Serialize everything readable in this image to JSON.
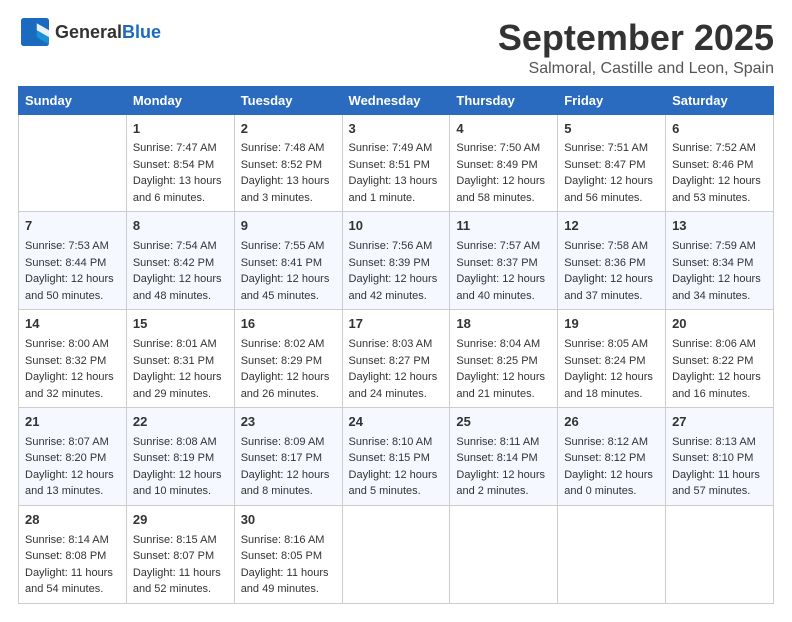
{
  "logo": {
    "general": "General",
    "blue": "Blue"
  },
  "header": {
    "month": "September 2025",
    "location": "Salmoral, Castille and Leon, Spain"
  },
  "weekdays": [
    "Sunday",
    "Monday",
    "Tuesday",
    "Wednesday",
    "Thursday",
    "Friday",
    "Saturday"
  ],
  "weeks": [
    [
      {
        "day": "",
        "info": ""
      },
      {
        "day": "1",
        "info": "Sunrise: 7:47 AM\nSunset: 8:54 PM\nDaylight: 13 hours\nand 6 minutes."
      },
      {
        "day": "2",
        "info": "Sunrise: 7:48 AM\nSunset: 8:52 PM\nDaylight: 13 hours\nand 3 minutes."
      },
      {
        "day": "3",
        "info": "Sunrise: 7:49 AM\nSunset: 8:51 PM\nDaylight: 13 hours\nand 1 minute."
      },
      {
        "day": "4",
        "info": "Sunrise: 7:50 AM\nSunset: 8:49 PM\nDaylight: 12 hours\nand 58 minutes."
      },
      {
        "day": "5",
        "info": "Sunrise: 7:51 AM\nSunset: 8:47 PM\nDaylight: 12 hours\nand 56 minutes."
      },
      {
        "day": "6",
        "info": "Sunrise: 7:52 AM\nSunset: 8:46 PM\nDaylight: 12 hours\nand 53 minutes."
      }
    ],
    [
      {
        "day": "7",
        "info": "Sunrise: 7:53 AM\nSunset: 8:44 PM\nDaylight: 12 hours\nand 50 minutes."
      },
      {
        "day": "8",
        "info": "Sunrise: 7:54 AM\nSunset: 8:42 PM\nDaylight: 12 hours\nand 48 minutes."
      },
      {
        "day": "9",
        "info": "Sunrise: 7:55 AM\nSunset: 8:41 PM\nDaylight: 12 hours\nand 45 minutes."
      },
      {
        "day": "10",
        "info": "Sunrise: 7:56 AM\nSunset: 8:39 PM\nDaylight: 12 hours\nand 42 minutes."
      },
      {
        "day": "11",
        "info": "Sunrise: 7:57 AM\nSunset: 8:37 PM\nDaylight: 12 hours\nand 40 minutes."
      },
      {
        "day": "12",
        "info": "Sunrise: 7:58 AM\nSunset: 8:36 PM\nDaylight: 12 hours\nand 37 minutes."
      },
      {
        "day": "13",
        "info": "Sunrise: 7:59 AM\nSunset: 8:34 PM\nDaylight: 12 hours\nand 34 minutes."
      }
    ],
    [
      {
        "day": "14",
        "info": "Sunrise: 8:00 AM\nSunset: 8:32 PM\nDaylight: 12 hours\nand 32 minutes."
      },
      {
        "day": "15",
        "info": "Sunrise: 8:01 AM\nSunset: 8:31 PM\nDaylight: 12 hours\nand 29 minutes."
      },
      {
        "day": "16",
        "info": "Sunrise: 8:02 AM\nSunset: 8:29 PM\nDaylight: 12 hours\nand 26 minutes."
      },
      {
        "day": "17",
        "info": "Sunrise: 8:03 AM\nSunset: 8:27 PM\nDaylight: 12 hours\nand 24 minutes."
      },
      {
        "day": "18",
        "info": "Sunrise: 8:04 AM\nSunset: 8:25 PM\nDaylight: 12 hours\nand 21 minutes."
      },
      {
        "day": "19",
        "info": "Sunrise: 8:05 AM\nSunset: 8:24 PM\nDaylight: 12 hours\nand 18 minutes."
      },
      {
        "day": "20",
        "info": "Sunrise: 8:06 AM\nSunset: 8:22 PM\nDaylight: 12 hours\nand 16 minutes."
      }
    ],
    [
      {
        "day": "21",
        "info": "Sunrise: 8:07 AM\nSunset: 8:20 PM\nDaylight: 12 hours\nand 13 minutes."
      },
      {
        "day": "22",
        "info": "Sunrise: 8:08 AM\nSunset: 8:19 PM\nDaylight: 12 hours\nand 10 minutes."
      },
      {
        "day": "23",
        "info": "Sunrise: 8:09 AM\nSunset: 8:17 PM\nDaylight: 12 hours\nand 8 minutes."
      },
      {
        "day": "24",
        "info": "Sunrise: 8:10 AM\nSunset: 8:15 PM\nDaylight: 12 hours\nand 5 minutes."
      },
      {
        "day": "25",
        "info": "Sunrise: 8:11 AM\nSunset: 8:14 PM\nDaylight: 12 hours\nand 2 minutes."
      },
      {
        "day": "26",
        "info": "Sunrise: 8:12 AM\nSunset: 8:12 PM\nDaylight: 12 hours\nand 0 minutes."
      },
      {
        "day": "27",
        "info": "Sunrise: 8:13 AM\nSunset: 8:10 PM\nDaylight: 11 hours\nand 57 minutes."
      }
    ],
    [
      {
        "day": "28",
        "info": "Sunrise: 8:14 AM\nSunset: 8:08 PM\nDaylight: 11 hours\nand 54 minutes."
      },
      {
        "day": "29",
        "info": "Sunrise: 8:15 AM\nSunset: 8:07 PM\nDaylight: 11 hours\nand 52 minutes."
      },
      {
        "day": "30",
        "info": "Sunrise: 8:16 AM\nSunset: 8:05 PM\nDaylight: 11 hours\nand 49 minutes."
      },
      {
        "day": "",
        "info": ""
      },
      {
        "day": "",
        "info": ""
      },
      {
        "day": "",
        "info": ""
      },
      {
        "day": "",
        "info": ""
      }
    ]
  ]
}
